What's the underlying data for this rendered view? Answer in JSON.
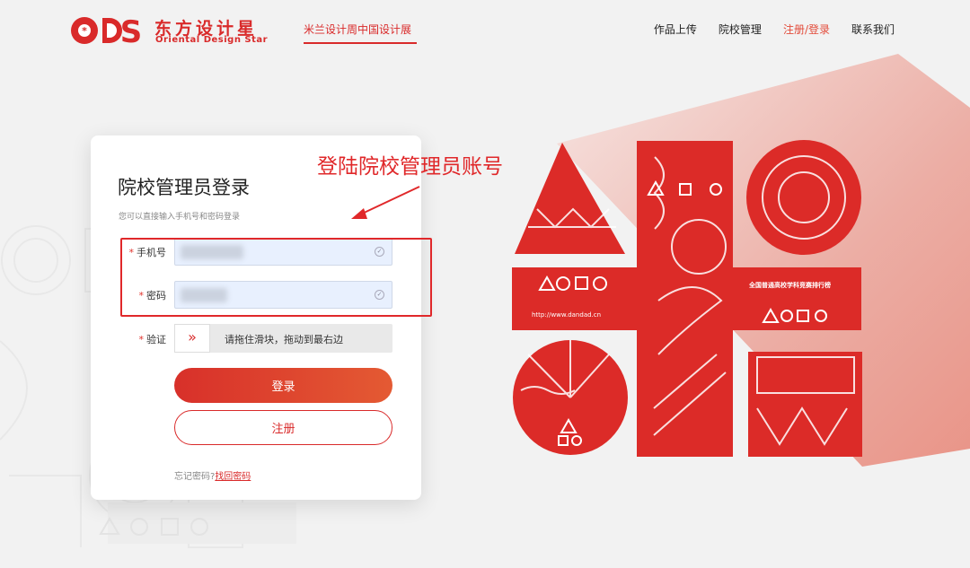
{
  "header": {
    "logo_cn": "东方设计星",
    "logo_en": "Oriental Design Star",
    "feature_link": "米兰设计周中国设计展",
    "nav": [
      {
        "label": "作品上传",
        "active": false
      },
      {
        "label": "院校管理",
        "active": false
      },
      {
        "label": "注册/登录",
        "active": true
      },
      {
        "label": "联系我们",
        "active": false
      }
    ]
  },
  "login": {
    "title": "院校管理员登录",
    "subtitle": "您可以直接输入手机号和密码登录",
    "phone_label": "手机号",
    "password_label": "密码",
    "verify_label": "验证",
    "required_mark": "*",
    "slider_text": "请拖住滑块，拖动到最右边",
    "slider_icon": "double-chevron-right-icon",
    "login_button": "登录",
    "register_button": "注册",
    "forgot_text": "忘记密码?",
    "forgot_link": "找回密码"
  },
  "annotation": {
    "text": "登陆院校管理员账号"
  },
  "poster": {
    "url": "http://www.dandad.cn",
    "ranking": "全国普通高校学科竞赛排行榜"
  },
  "colors": {
    "brand_red": "#d92a2a",
    "nav_active": "#e34b3a",
    "annotation_red": "#e0282a"
  }
}
